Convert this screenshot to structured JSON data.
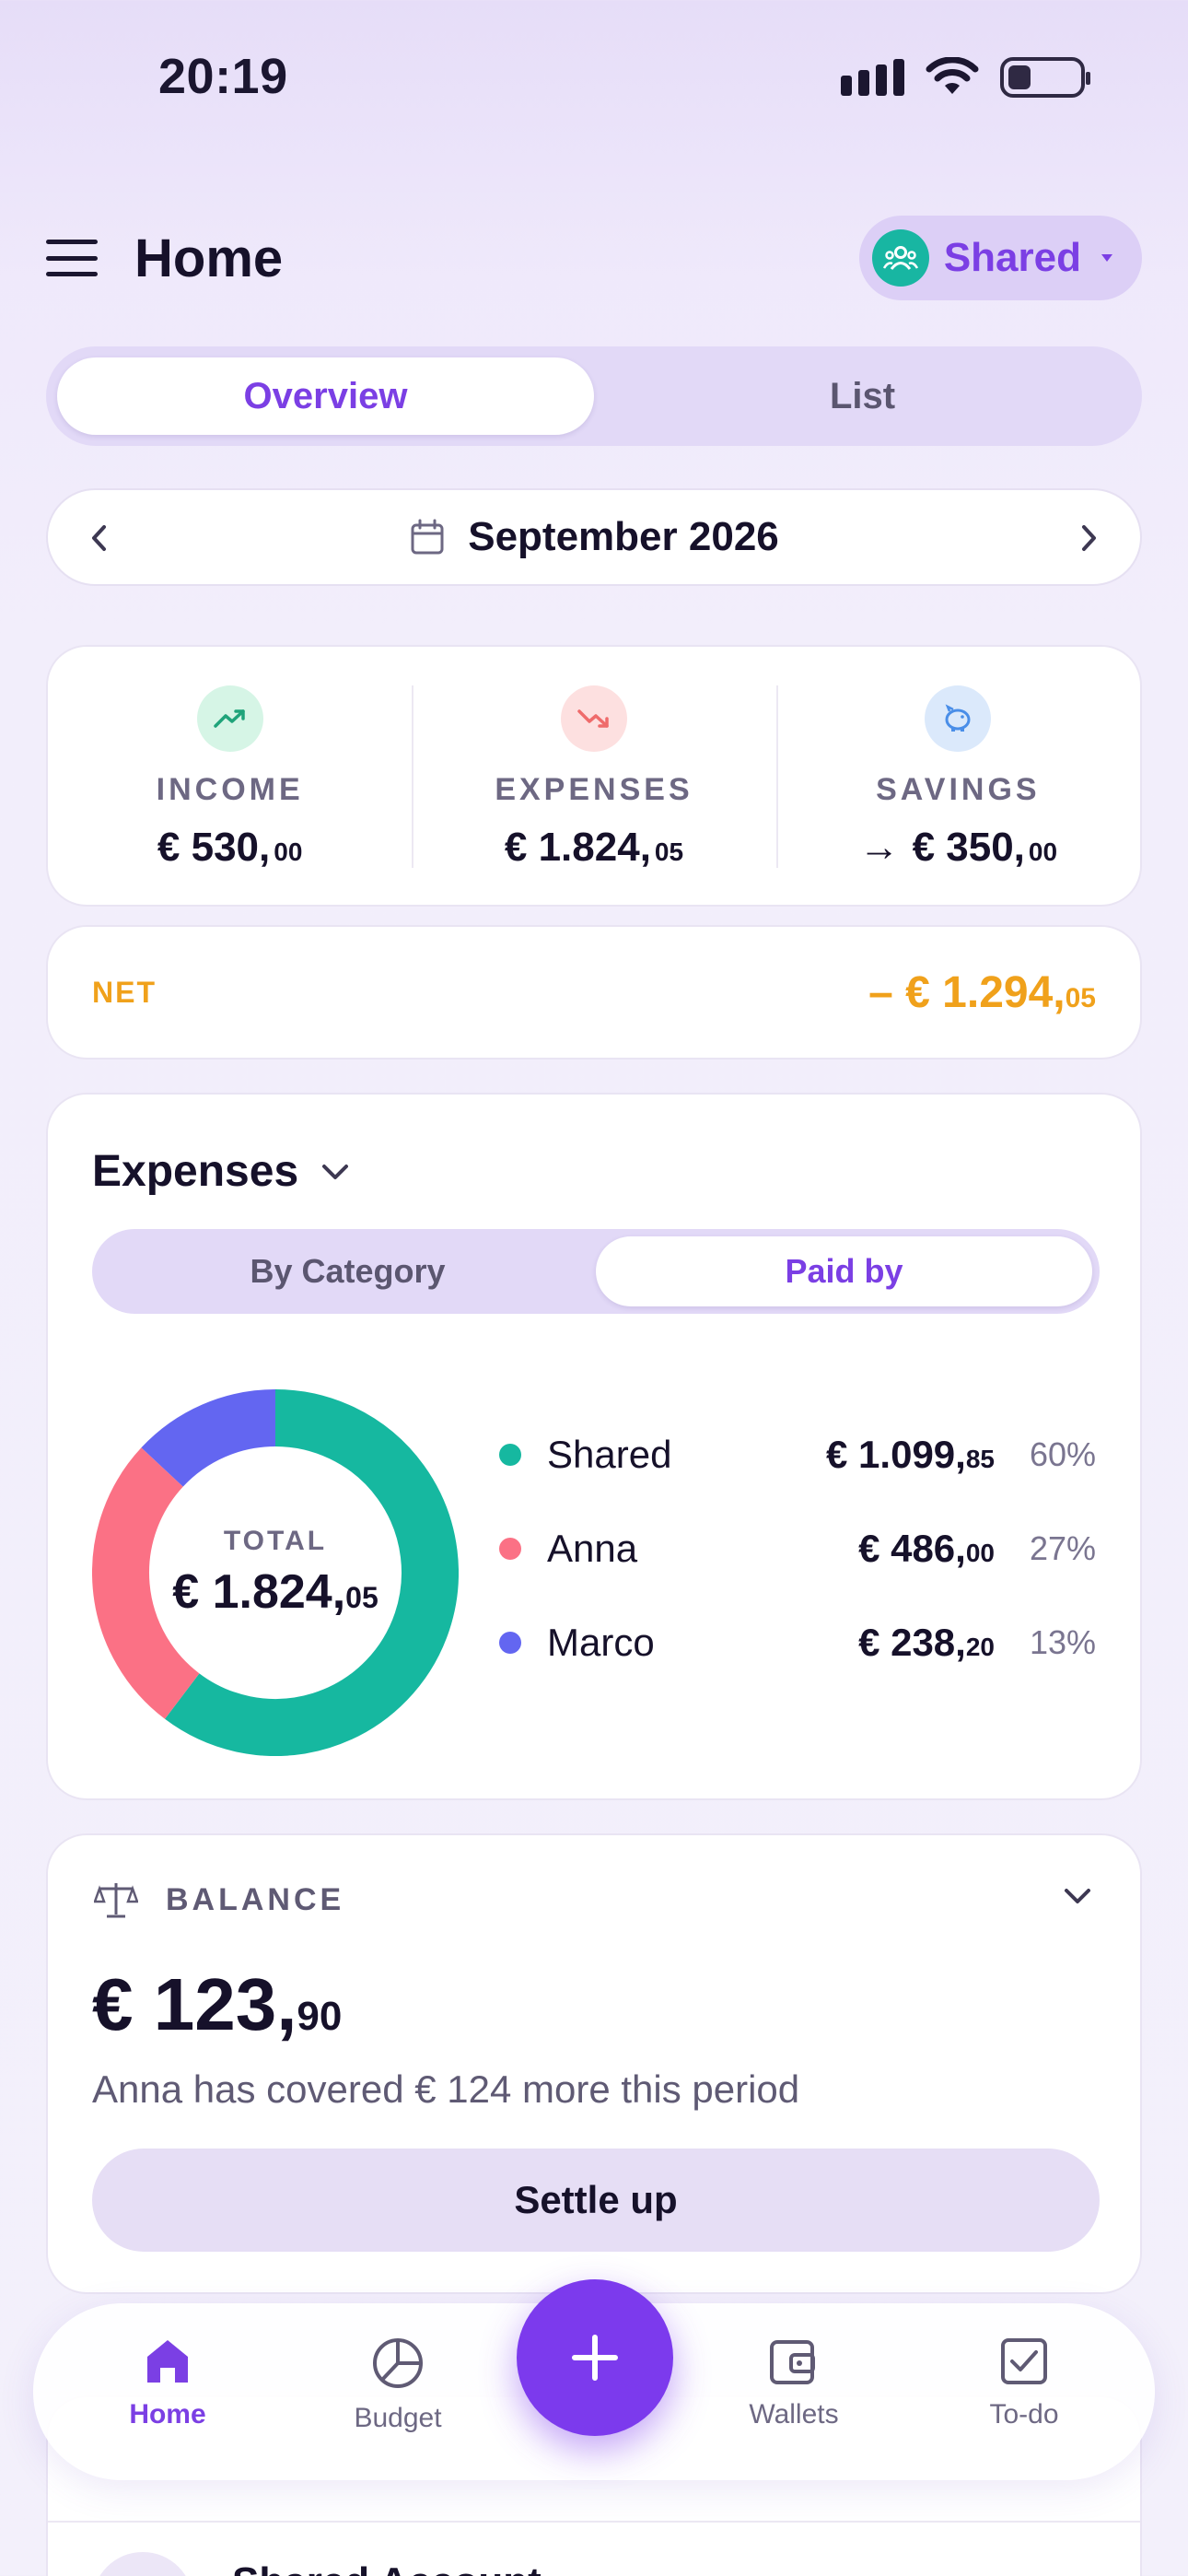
{
  "status_bar": {
    "time": "20:19"
  },
  "header": {
    "title": "Home",
    "account_label": "Shared"
  },
  "main_tabs": {
    "overview": "Overview",
    "list": "List",
    "active": "overview"
  },
  "month": {
    "label": "September 2026"
  },
  "summary": {
    "income": {
      "label": "INCOME",
      "value": "€ 530,",
      "cents": "00"
    },
    "expenses": {
      "label": "EXPENSES",
      "value": "€ 1.824,",
      "cents": "05"
    },
    "savings": {
      "label": "SAVINGS",
      "prefix": "→",
      "value": "€ 350,",
      "cents": "00"
    }
  },
  "net": {
    "label": "NET",
    "value": "– € 1.294,",
    "cents": "05"
  },
  "expenses_card": {
    "title": "Expenses",
    "tabs": {
      "by_category": "By Category",
      "paid_by": "Paid by",
      "active": "paid_by"
    },
    "total_label": "TOTAL",
    "total_value": "€ 1.824,",
    "total_cents": "05",
    "rows": [
      {
        "name": "Shared",
        "amount": "€ 1.099,",
        "cents": "85",
        "pct": "60%",
        "color": "#16b8a0"
      },
      {
        "name": "Anna",
        "amount": "€ 486,",
        "cents": "00",
        "pct": "27%",
        "color": "#fb7185"
      },
      {
        "name": "Marco",
        "amount": "€ 238,",
        "cents": "20",
        "pct": "13%",
        "color": "#6366f1"
      }
    ]
  },
  "chart_data": {
    "type": "pie",
    "categories": [
      "Shared",
      "Anna",
      "Marco"
    ],
    "values": [
      1099.85,
      486.0,
      238.2
    ],
    "percentages": [
      60,
      27,
      13
    ],
    "colors": [
      "#16b8a0",
      "#fb7185",
      "#6366f1"
    ],
    "title": "",
    "center_label": "TOTAL",
    "center_value": "€ 1.824,05"
  },
  "balance": {
    "label": "BALANCE",
    "value": "€ 123,",
    "cents": "90",
    "note": "Anna has covered € 124 more this period",
    "settle_label": "Settle up"
  },
  "peek_card": {
    "title": "Shared Account"
  },
  "bottom_nav": {
    "items": [
      {
        "label": "Home",
        "icon": "home-icon"
      },
      {
        "label": "Budget",
        "icon": "pie-chart-icon"
      },
      {
        "label": "Wallets",
        "icon": "wallet-icon"
      },
      {
        "label": "To-do",
        "icon": "checkbox-icon"
      }
    ],
    "fab_icon": "plus-icon"
  },
  "colors": {
    "accent": "#7c3aed",
    "net": "#f0a11b",
    "income": "#1fa37a",
    "expenses": "#ef6b6b",
    "savings": "#4a8ee8"
  }
}
